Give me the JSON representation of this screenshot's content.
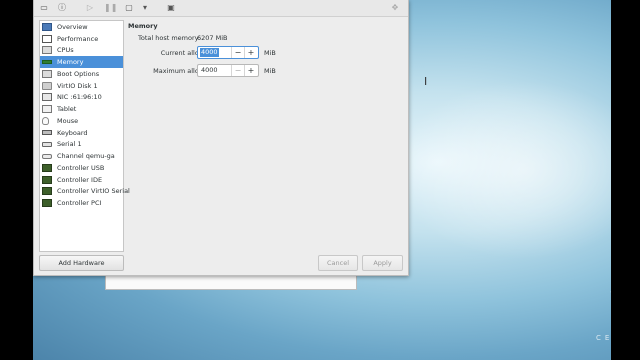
{
  "toolbar": {
    "buttons": [
      {
        "icon": "monitor-icon",
        "glyph": "▭"
      },
      {
        "icon": "info-icon",
        "glyph": "ⓘ"
      },
      {
        "icon": "play-icon",
        "glyph": "▷"
      },
      {
        "icon": "pause-icon",
        "glyph": "❚❚"
      },
      {
        "icon": "power-icon",
        "glyph": "▢"
      },
      {
        "icon": "dropdown-icon",
        "glyph": "▾"
      },
      {
        "icon": "console-icon",
        "glyph": "▣"
      },
      {
        "icon": "fullscreen-icon",
        "glyph": "✥"
      }
    ]
  },
  "sidebar": {
    "items": [
      {
        "label": "Overview",
        "icon": "info-icon"
      },
      {
        "label": "Performance",
        "icon": "chart-icon"
      },
      {
        "label": "CPUs",
        "icon": "cpu-icon"
      },
      {
        "label": "Memory",
        "icon": "memory-icon"
      },
      {
        "label": "Boot Options",
        "icon": "boot-options-icon"
      },
      {
        "label": "VirtIO Disk 1",
        "icon": "disk-icon"
      },
      {
        "label": "NIC :61:96:10",
        "icon": "network-icon"
      },
      {
        "label": "Tablet",
        "icon": "tablet-icon"
      },
      {
        "label": "Mouse",
        "icon": "mouse-icon"
      },
      {
        "label": "Keyboard",
        "icon": "keyboard-icon"
      },
      {
        "label": "Serial 1",
        "icon": "serial-icon"
      },
      {
        "label": "Channel qemu-ga",
        "icon": "channel-icon"
      },
      {
        "label": "Controller USB",
        "icon": "controller-icon"
      },
      {
        "label": "Controller IDE",
        "icon": "controller-icon"
      },
      {
        "label": "Controller VirtIO Serial",
        "icon": "controller-icon"
      },
      {
        "label": "Controller PCI",
        "icon": "controller-icon"
      }
    ],
    "selected_index": 3,
    "add_hardware_label": "Add Hardware"
  },
  "detail": {
    "title": "Memory",
    "total_label": "Total host memory:",
    "total_value": "6207 MiB",
    "current_label": "Current allocation:",
    "current_value": "4000",
    "current_unit": "MiB",
    "max_label": "Maximum allocation:",
    "max_value": "4000",
    "max_unit": "MiB"
  },
  "buttons": {
    "cancel": "Cancel",
    "apply": "Apply"
  },
  "desktop": {
    "brand_number": "7",
    "brand_text": "CENTO"
  },
  "colors": {
    "selection": "#4a90d9",
    "window_bg": "#ededed"
  }
}
